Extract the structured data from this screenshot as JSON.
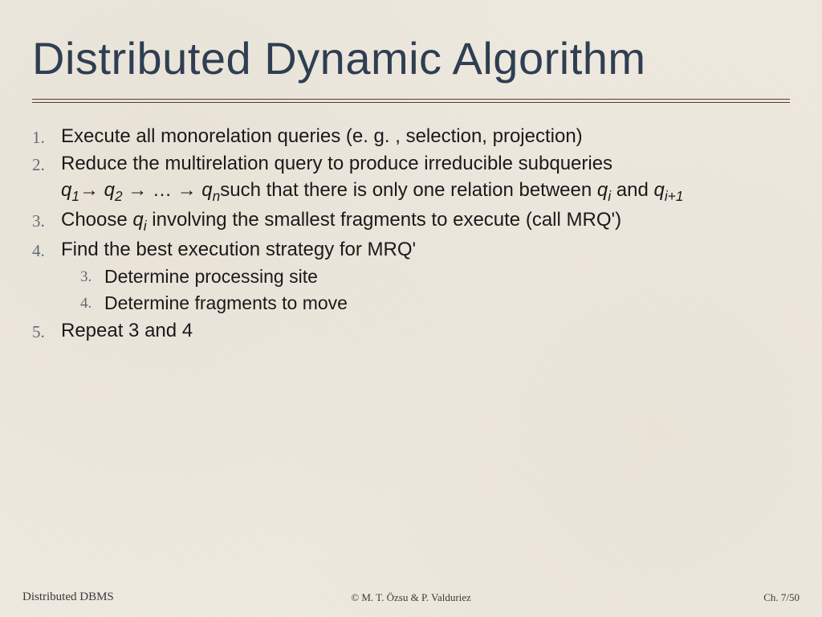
{
  "title": "Distributed Dynamic Algorithm",
  "items": {
    "n1": "1.",
    "t1": "Execute all monorelation queries (e. g. , selection, projection)",
    "n2": "2.",
    "t2a": "Reduce the multirelation query to produce irreducible subqueries",
    "t2b_tail": "such that there is only one relation between ",
    "t2b_and": " and ",
    "n3": "3.",
    "t3a": "Choose ",
    "t3b": " involving the smallest fragments to execute (call MRQ')",
    "n4": "4.",
    "t4": "Find the best execution strategy for MRQ'",
    "sn3": "3.",
    "st3": "Determine processing site",
    "sn4": "4.",
    "st4": "Determine fragments to move",
    "n5": "5.",
    "t5": "Repeat 3 and 4"
  },
  "footer": {
    "left": "Distributed DBMS",
    "center": "© M. T. Özsu & P. Valduriez",
    "right": "Ch. 7/50"
  }
}
